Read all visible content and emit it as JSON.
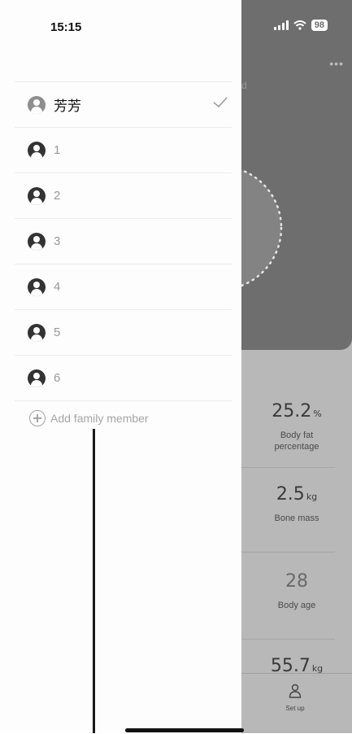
{
  "status_bar": {
    "time": "15:15",
    "battery": "98"
  },
  "drawer": {
    "members": [
      {
        "name": "芳芳",
        "selected": true
      },
      {
        "name": "1",
        "selected": false
      },
      {
        "name": "2",
        "selected": false
      },
      {
        "name": "3",
        "selected": false
      },
      {
        "name": "4",
        "selected": false
      },
      {
        "name": "5",
        "selected": false
      },
      {
        "name": "6",
        "selected": false
      }
    ],
    "add_label": "Add family member"
  },
  "background": {
    "header_fragment": "d",
    "metrics": [
      {
        "value": "25.2",
        "unit": "%",
        "label": "Body fat percentage"
      },
      {
        "value": "2.5",
        "unit": "kg",
        "label": "Bone mass"
      },
      {
        "value": "28",
        "unit": "",
        "label": "Body age"
      },
      {
        "value": "55.7",
        "unit": "kg",
        "label": ""
      }
    ],
    "tab_setup_label": "Set up"
  },
  "icons": {
    "user": "user-avatar-icon",
    "check": "check-icon",
    "add": "plus-circle-icon",
    "person": "person-icon"
  },
  "colors": {
    "overlay": "#6e6e6e",
    "text_primary": "#111111",
    "text_muted": "#999999"
  }
}
